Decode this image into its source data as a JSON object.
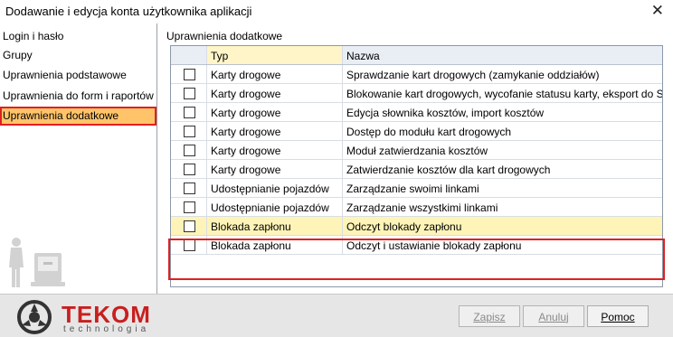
{
  "window": {
    "title": "Dodawanie i edycja konta użytkownika aplikacji",
    "close_glyph": "✕"
  },
  "sidebar": {
    "items": [
      {
        "label": "Login i hasło"
      },
      {
        "label": "Grupy"
      },
      {
        "label": "Uprawnienia podstawowe"
      },
      {
        "label": "Uprawnienia do form i raportów"
      },
      {
        "label": "Uprawnienia dodatkowe",
        "selected": true
      }
    ]
  },
  "main": {
    "section_label": "Uprawnienia dodatkowe",
    "columns": [
      "",
      "Typ",
      "Nazwa"
    ],
    "rows": [
      {
        "checked": false,
        "typ": "Karty drogowe",
        "nazwa": "Sprawdzanie kart drogowych (zamykanie oddziałów)"
      },
      {
        "checked": false,
        "typ": "Karty drogowe",
        "nazwa": "Blokowanie kart drogowych, wycofanie statusu karty, eksport do SAP"
      },
      {
        "checked": false,
        "typ": "Karty drogowe",
        "nazwa": "Edycja słownika kosztów, import kosztów"
      },
      {
        "checked": false,
        "typ": "Karty drogowe",
        "nazwa": "Dostęp do modułu kart drogowych"
      },
      {
        "checked": false,
        "typ": "Karty drogowe",
        "nazwa": "Moduł zatwierdzania kosztów"
      },
      {
        "checked": false,
        "typ": "Karty drogowe",
        "nazwa": "Zatwierdzanie kosztów dla kart drogowych"
      },
      {
        "checked": false,
        "typ": "Udostępnianie pojazdów",
        "nazwa": "Zarządzanie swoimi linkami"
      },
      {
        "checked": false,
        "typ": "Udostępnianie pojazdów",
        "nazwa": "Zarządzanie wszystkimi linkami"
      },
      {
        "checked": false,
        "typ": "Blokada zapłonu",
        "nazwa": "Odczyt blokady zapłonu"
      },
      {
        "checked": false,
        "typ": "Blokada zapłonu",
        "nazwa": "Odczyt i ustawianie blokady zapłonu"
      }
    ]
  },
  "footer": {
    "logo_name": "TEKOM",
    "logo_sub": "technologia",
    "buttons": {
      "save": "Zapisz",
      "cancel": "Anuluj",
      "help": "Pomoc"
    }
  },
  "colors": {
    "selection": "#ffc46a",
    "highlight_box": "#e02020",
    "brand_red": "#c81f1f"
  }
}
